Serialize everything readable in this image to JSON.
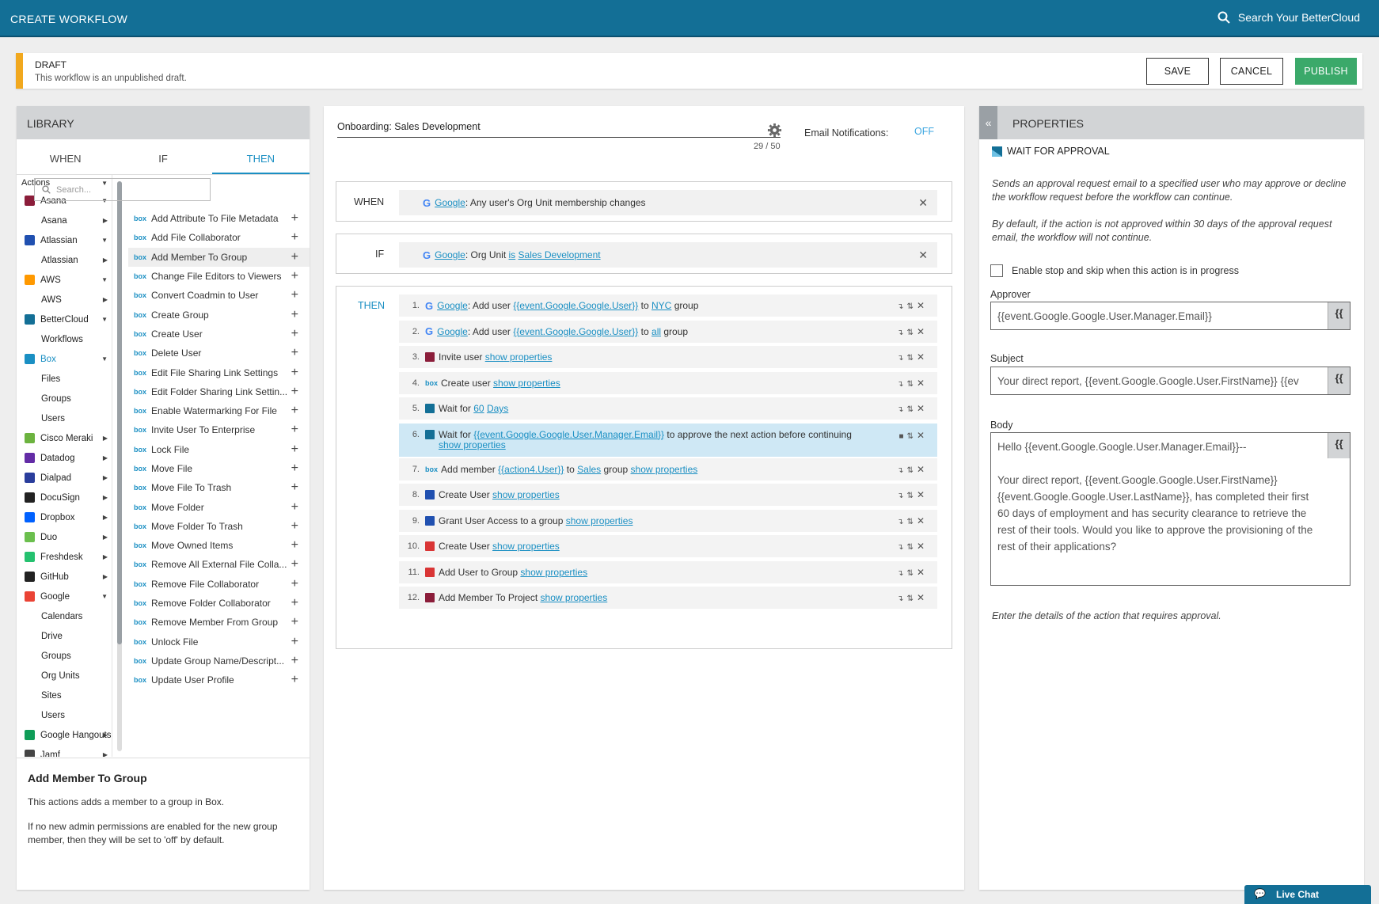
{
  "header": {
    "title": "CREATE WORKFLOW",
    "search_label": "Search Your BetterCloud"
  },
  "draft": {
    "status": "DRAFT",
    "message": "This workflow is an unpublished draft.",
    "save": "SAVE",
    "cancel": "CANCEL",
    "publish": "PUBLISH"
  },
  "library": {
    "title": "LIBRARY",
    "tabs": [
      "WHEN",
      "IF",
      "THEN"
    ],
    "actions_header": "Actions",
    "search_placeholder": "Search...",
    "categories": [
      {
        "label": "Asana",
        "color": "#8b1d3a"
      },
      {
        "label": "Asana",
        "sub": true
      },
      {
        "label": "Atlassian",
        "color": "#2050b0"
      },
      {
        "label": "Atlassian",
        "sub": true
      },
      {
        "label": "AWS",
        "color": "#ff9900"
      },
      {
        "label": "AWS",
        "sub": true
      },
      {
        "label": "BetterCloud",
        "color": "#136f96"
      },
      {
        "label": "Workflows",
        "sub": true
      },
      {
        "label": "Box",
        "color": "#1a8fc3"
      },
      {
        "label": "Files",
        "sub": true
      },
      {
        "label": "Groups",
        "sub": true
      },
      {
        "label": "Users",
        "sub": true
      },
      {
        "label": "Cisco Meraki",
        "color": "#6cb33f"
      },
      {
        "label": "Datadog",
        "color": "#632ca6"
      },
      {
        "label": "Dialpad",
        "color": "#2a3d9c"
      },
      {
        "label": "DocuSign",
        "color": "#222222"
      },
      {
        "label": "Dropbox",
        "color": "#0061ff"
      },
      {
        "label": "Duo",
        "color": "#6bbf4e"
      },
      {
        "label": "Freshdesk",
        "color": "#25c16f"
      },
      {
        "label": "GitHub",
        "color": "#222222"
      },
      {
        "label": "Google",
        "color": "#ea4335"
      },
      {
        "label": "Calendars",
        "sub": true
      },
      {
        "label": "Drive",
        "sub": true
      },
      {
        "label": "Groups",
        "sub": true
      },
      {
        "label": "Org Units",
        "sub": true
      },
      {
        "label": "Sites",
        "sub": true
      },
      {
        "label": "Users",
        "sub": true
      },
      {
        "label": "Google Hangouts",
        "color": "#0f9d58"
      },
      {
        "label": "Jamf",
        "color": "#444444"
      }
    ],
    "actions": [
      "Add Attribute To File Metadata",
      "Add File Collaborator",
      "Add Member To Group",
      "Change File Editors to Viewers",
      "Convert Coadmin to User",
      "Create Group",
      "Create User",
      "Delete User",
      "Edit File Sharing Link Settings",
      "Edit Folder Sharing Link Settin...",
      "Enable Watermarking For File",
      "Invite User To Enterprise",
      "Lock File",
      "Move File",
      "Move File To Trash",
      "Move Folder",
      "Move Folder To Trash",
      "Move Owned Items",
      "Remove All External File Colla...",
      "Remove File Collaborator",
      "Remove Folder Collaborator",
      "Remove Member From Group",
      "Unlock File",
      "Update Group Name/Descript...",
      "Update User Profile"
    ],
    "desc_title": "Add Member To Group",
    "desc_p1": "This actions adds a member to a group in Box.",
    "desc_p2": "If no new admin permissions are enabled for the new group member, then they will be set to 'off' by default."
  },
  "canvas": {
    "name": "Onboarding: Sales Development",
    "count": "29 / 50",
    "email_label": "Email Notifications:",
    "email_value": "OFF",
    "when_label": "WHEN",
    "if_label": "IF",
    "then_label": "THEN",
    "when": {
      "app": "Google",
      "text": ": Any user's Org Unit membership changes"
    },
    "if": {
      "app": "Google",
      "text1": ": Org Unit ",
      "is": "is",
      "value": "Sales Development"
    },
    "steps": [
      {
        "num": "1.",
        "icon": "google",
        "pre": "Google",
        "t1": ": Add user ",
        "v1": "{{event.Google.Google.User}}",
        "t2": " to ",
        "v2": "NYC",
        "t3": " group"
      },
      {
        "num": "2.",
        "icon": "google",
        "pre": "Google",
        "t1": ": Add user ",
        "v1": "{{event.Google.Google.User}}",
        "t2": " to ",
        "v2": "all",
        "t3": " group"
      },
      {
        "num": "3.",
        "icon": "asana",
        "t1": "Invite user ",
        "v1": "show properties"
      },
      {
        "num": "4.",
        "icon": "box",
        "t1": "Create user ",
        "v1": "show properties"
      },
      {
        "num": "5.",
        "icon": "bettercloud",
        "t1": "Wait for ",
        "v1": "60",
        "t2": " ",
        "v2": "Days"
      },
      {
        "num": "6.",
        "icon": "bettercloud",
        "t1": "Wait for ",
        "v1": "{{event.Google.Google.User.Manager.Email}}",
        "t2": " to approve the next action before continuing",
        "v2": "show properties"
      },
      {
        "num": "7.",
        "icon": "box",
        "t1": "Add member ",
        "v1": "{{action4.User}}",
        "t2": " to ",
        "v2": "Sales",
        "t3": " group ",
        "v3": "show properties"
      },
      {
        "num": "8.",
        "icon": "atlassian",
        "t1": "Create User ",
        "v1": "show properties"
      },
      {
        "num": "9.",
        "icon": "atlassian",
        "t1": "Grant User Access to a group ",
        "v1": "show properties"
      },
      {
        "num": "10.",
        "icon": "red",
        "t1": "Create User ",
        "v1": "show properties"
      },
      {
        "num": "11.",
        "icon": "red",
        "t1": "Add User to Group ",
        "v1": "show properties"
      },
      {
        "num": "12.",
        "icon": "asana",
        "t1": "Add Member To Project ",
        "v1": "show properties"
      }
    ]
  },
  "properties": {
    "title": "PROPERTIES",
    "action": "WAIT FOR APPROVAL",
    "desc1": "Sends an approval request email to a specified user who may approve or decline the workflow request before the workflow can continue.",
    "desc2": "By default, if the action is not approved within 30 days of the approval request email, the workflow will not continue.",
    "checkbox": "Enable stop and skip when this action is in progress",
    "approver_label": "Approver",
    "approver_value": "{{event.Google.Google.User.Manager.Email}}",
    "subject_label": "Subject",
    "subject_value": "Your direct report, {{event.Google.Google.User.FirstName}} {{ev",
    "body_label": "Body",
    "body_line1": "Hello {{event.Google.Google.User.Manager.Email}}--",
    "body_line2": "Your direct report, {{event.Google.Google.User.FirstName}} {{event.Google.Google.User.LastName}}, has completed their first 60 days of employment and has security clearance to retrieve the rest of their tools. Would you like to approve the provisioning of the rest of their applications?",
    "footer": "Enter the details of the action that requires approval.",
    "template_glyph": "{{"
  },
  "livechat": "Live Chat"
}
